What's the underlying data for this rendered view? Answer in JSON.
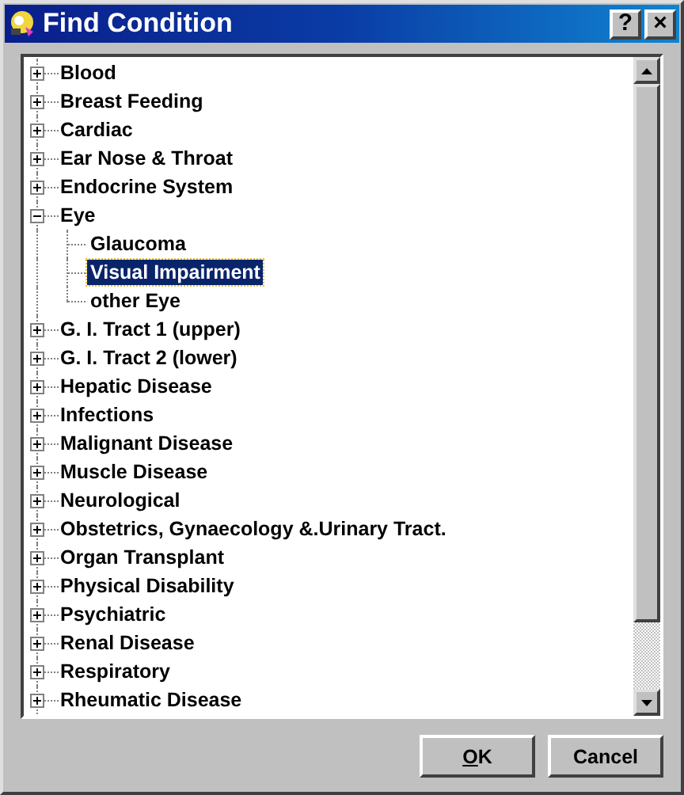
{
  "window": {
    "title": "Find Condition"
  },
  "title_buttons": [
    "?",
    "×"
  ],
  "tree": [
    {
      "label": "Blood",
      "expanded": false,
      "selected": false
    },
    {
      "label": "Breast Feeding",
      "expanded": false,
      "selected": false
    },
    {
      "label": "Cardiac",
      "expanded": false,
      "selected": false
    },
    {
      "label": "Ear Nose & Throat",
      "expanded": false,
      "selected": false
    },
    {
      "label": "Endocrine System",
      "expanded": false,
      "selected": false
    },
    {
      "label": "Eye",
      "expanded": true,
      "selected": false,
      "children": [
        {
          "label": "Glaucoma",
          "selected": false
        },
        {
          "label": "Visual Impairment",
          "selected": true
        },
        {
          "label": "other Eye",
          "selected": false
        }
      ]
    },
    {
      "label": "G. I. Tract 1 (upper)",
      "expanded": false,
      "selected": false
    },
    {
      "label": "G. I. Tract 2 (lower)",
      "expanded": false,
      "selected": false
    },
    {
      "label": "Hepatic Disease",
      "expanded": false,
      "selected": false
    },
    {
      "label": "Infections",
      "expanded": false,
      "selected": false
    },
    {
      "label": "Malignant Disease",
      "expanded": false,
      "selected": false
    },
    {
      "label": "Muscle Disease",
      "expanded": false,
      "selected": false
    },
    {
      "label": "Neurological",
      "expanded": false,
      "selected": false
    },
    {
      "label": "Obstetrics, Gynaecology &.Urinary Tract.",
      "expanded": false,
      "selected": false
    },
    {
      "label": "Organ Transplant",
      "expanded": false,
      "selected": false
    },
    {
      "label": "Physical Disability",
      "expanded": false,
      "selected": false
    },
    {
      "label": "Psychiatric",
      "expanded": false,
      "selected": false
    },
    {
      "label": "Renal Disease",
      "expanded": false,
      "selected": false
    },
    {
      "label": "Respiratory",
      "expanded": false,
      "selected": false
    },
    {
      "label": "Rheumatic Disease",
      "expanded": false,
      "selected": false
    }
  ],
  "buttons": [
    {
      "label": "OK",
      "underline_first": true
    },
    {
      "label": "Cancel",
      "underline_first": false
    }
  ]
}
